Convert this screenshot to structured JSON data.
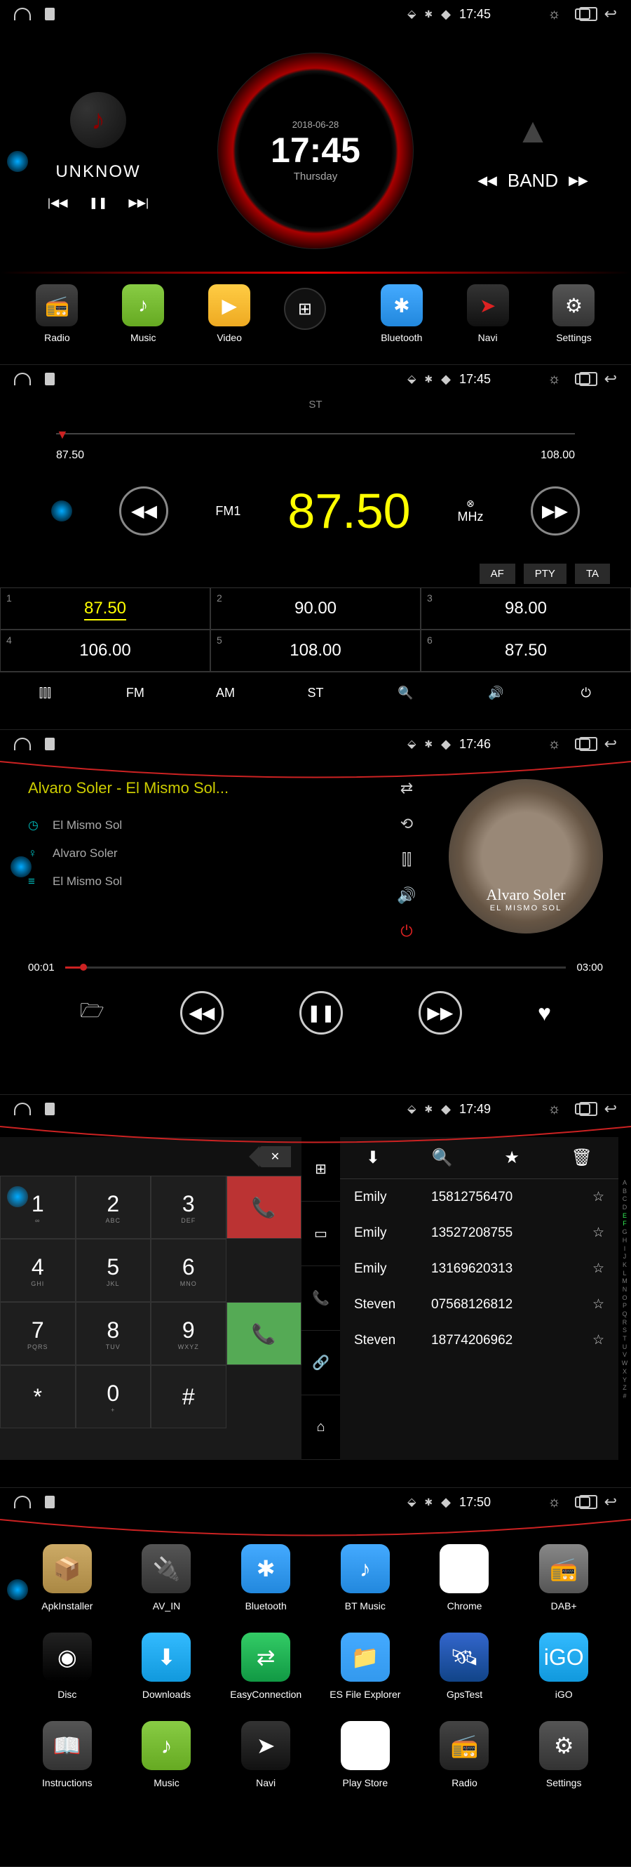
{
  "screens": {
    "s1": {
      "statusbar": {
        "time": "17:45"
      },
      "music": {
        "title": "UNKNOW"
      },
      "clock": {
        "date": "2018-06-28",
        "time": "17:45",
        "day": "Thursday"
      },
      "band": {
        "label": "BAND"
      },
      "dock": [
        {
          "label": "Radio"
        },
        {
          "label": "Music"
        },
        {
          "label": "Video"
        },
        {
          "label": "Bluetooth"
        },
        {
          "label": "Navi"
        },
        {
          "label": "Settings"
        }
      ]
    },
    "s2": {
      "statusbar": {
        "time": "17:45"
      },
      "st_label": "ST",
      "freq_min": "87.50",
      "freq_max": "108.00",
      "band": "FM1",
      "freq": "87.50",
      "unit": "MHz",
      "flags": [
        "AF",
        "PTY",
        "TA"
      ],
      "presets": [
        {
          "n": "1",
          "v": "87.50",
          "active": true
        },
        {
          "n": "2",
          "v": "90.00"
        },
        {
          "n": "3",
          "v": "98.00"
        },
        {
          "n": "4",
          "v": "106.00"
        },
        {
          "n": "5",
          "v": "108.00"
        },
        {
          "n": "6",
          "v": "87.50"
        }
      ],
      "bottom": {
        "fm": "FM",
        "am": "AM",
        "st": "ST"
      }
    },
    "s3": {
      "statusbar": {
        "time": "17:46"
      },
      "title": "Alvaro Soler - El Mismo Sol...",
      "track": "El Mismo Sol",
      "artist": "Alvaro Soler",
      "album": "El Mismo Sol",
      "art_name": "Alvaro Soler",
      "art_sub": "EL MISMO SOL",
      "pos": "00:01",
      "dur": "03:00"
    },
    "s4": {
      "statusbar": {
        "time": "17:49"
      },
      "keys": [
        {
          "n": "1",
          "s": "∞"
        },
        {
          "n": "2",
          "s": "ABC"
        },
        {
          "n": "3",
          "s": "DEF"
        },
        {
          "n": "4",
          "s": "GHI"
        },
        {
          "n": "5",
          "s": "JKL"
        },
        {
          "n": "6",
          "s": "MNO"
        },
        {
          "n": "7",
          "s": "PQRS"
        },
        {
          "n": "8",
          "s": "TUV"
        },
        {
          "n": "9",
          "s": "WXYZ"
        },
        {
          "n": "*",
          "s": ""
        },
        {
          "n": "0",
          "s": "+"
        },
        {
          "n": "#",
          "s": ""
        }
      ],
      "contacts": [
        {
          "name": "Emily",
          "num": "15812756470"
        },
        {
          "name": "Emily",
          "num": "13527208755"
        },
        {
          "name": "Emily",
          "num": "13169620313"
        },
        {
          "name": "Steven",
          "num": "07568126812"
        },
        {
          "name": "Steven",
          "num": "18774206962"
        }
      ],
      "alpha": [
        "A",
        "B",
        "C",
        "D",
        "E",
        "F",
        "G",
        "H",
        "I",
        "J",
        "K",
        "L",
        "M",
        "N",
        "O",
        "P",
        "Q",
        "R",
        "S",
        "T",
        "U",
        "V",
        "W",
        "X",
        "Y",
        "Z",
        "#"
      ]
    },
    "s5": {
      "statusbar": {
        "time": "17:50"
      },
      "apps": [
        {
          "label": "ApkInstaller",
          "bg": "linear-gradient(#ca6,#a84)",
          "g": "📦"
        },
        {
          "label": "AV_IN",
          "bg": "linear-gradient(#555,#333)",
          "g": "🔌"
        },
        {
          "label": "Bluetooth",
          "bg": "linear-gradient(#4af,#28d)",
          "g": "✱"
        },
        {
          "label": "BT Music",
          "bg": "linear-gradient(#4af,#28d)",
          "g": "♪"
        },
        {
          "label": "Chrome",
          "bg": "#fff",
          "g": "◉"
        },
        {
          "label": "DAB+",
          "bg": "linear-gradient(#888,#555)",
          "g": "📻"
        },
        {
          "label": "Disc",
          "bg": "linear-gradient(#222,#000)",
          "g": "◉"
        },
        {
          "label": "Downloads",
          "bg": "linear-gradient(#3bf,#19d)",
          "g": "⬇"
        },
        {
          "label": "EasyConnection",
          "bg": "linear-gradient(#3c6,#194)",
          "g": "⇄"
        },
        {
          "label": "ES File Explorer",
          "bg": "linear-gradient(#4af,#39e)",
          "g": "📁"
        },
        {
          "label": "GpsTest",
          "bg": "linear-gradient(#36c,#148)",
          "g": "🛰"
        },
        {
          "label": "iGO",
          "bg": "linear-gradient(#3bf,#19d)",
          "g": "iGO"
        },
        {
          "label": "Instructions",
          "bg": "linear-gradient(#555,#333)",
          "g": "📖"
        },
        {
          "label": "Music",
          "bg": "linear-gradient(#8c4,#6a2)",
          "g": "♪"
        },
        {
          "label": "Navi",
          "bg": "linear-gradient(#333,#111)",
          "g": "➤"
        },
        {
          "label": "Play Store",
          "bg": "#fff",
          "g": "▶"
        },
        {
          "label": "Radio",
          "bg": "linear-gradient(#444,#222)",
          "g": "📻"
        },
        {
          "label": "Settings",
          "bg": "linear-gradient(#555,#333)",
          "g": "⚙"
        }
      ]
    }
  }
}
